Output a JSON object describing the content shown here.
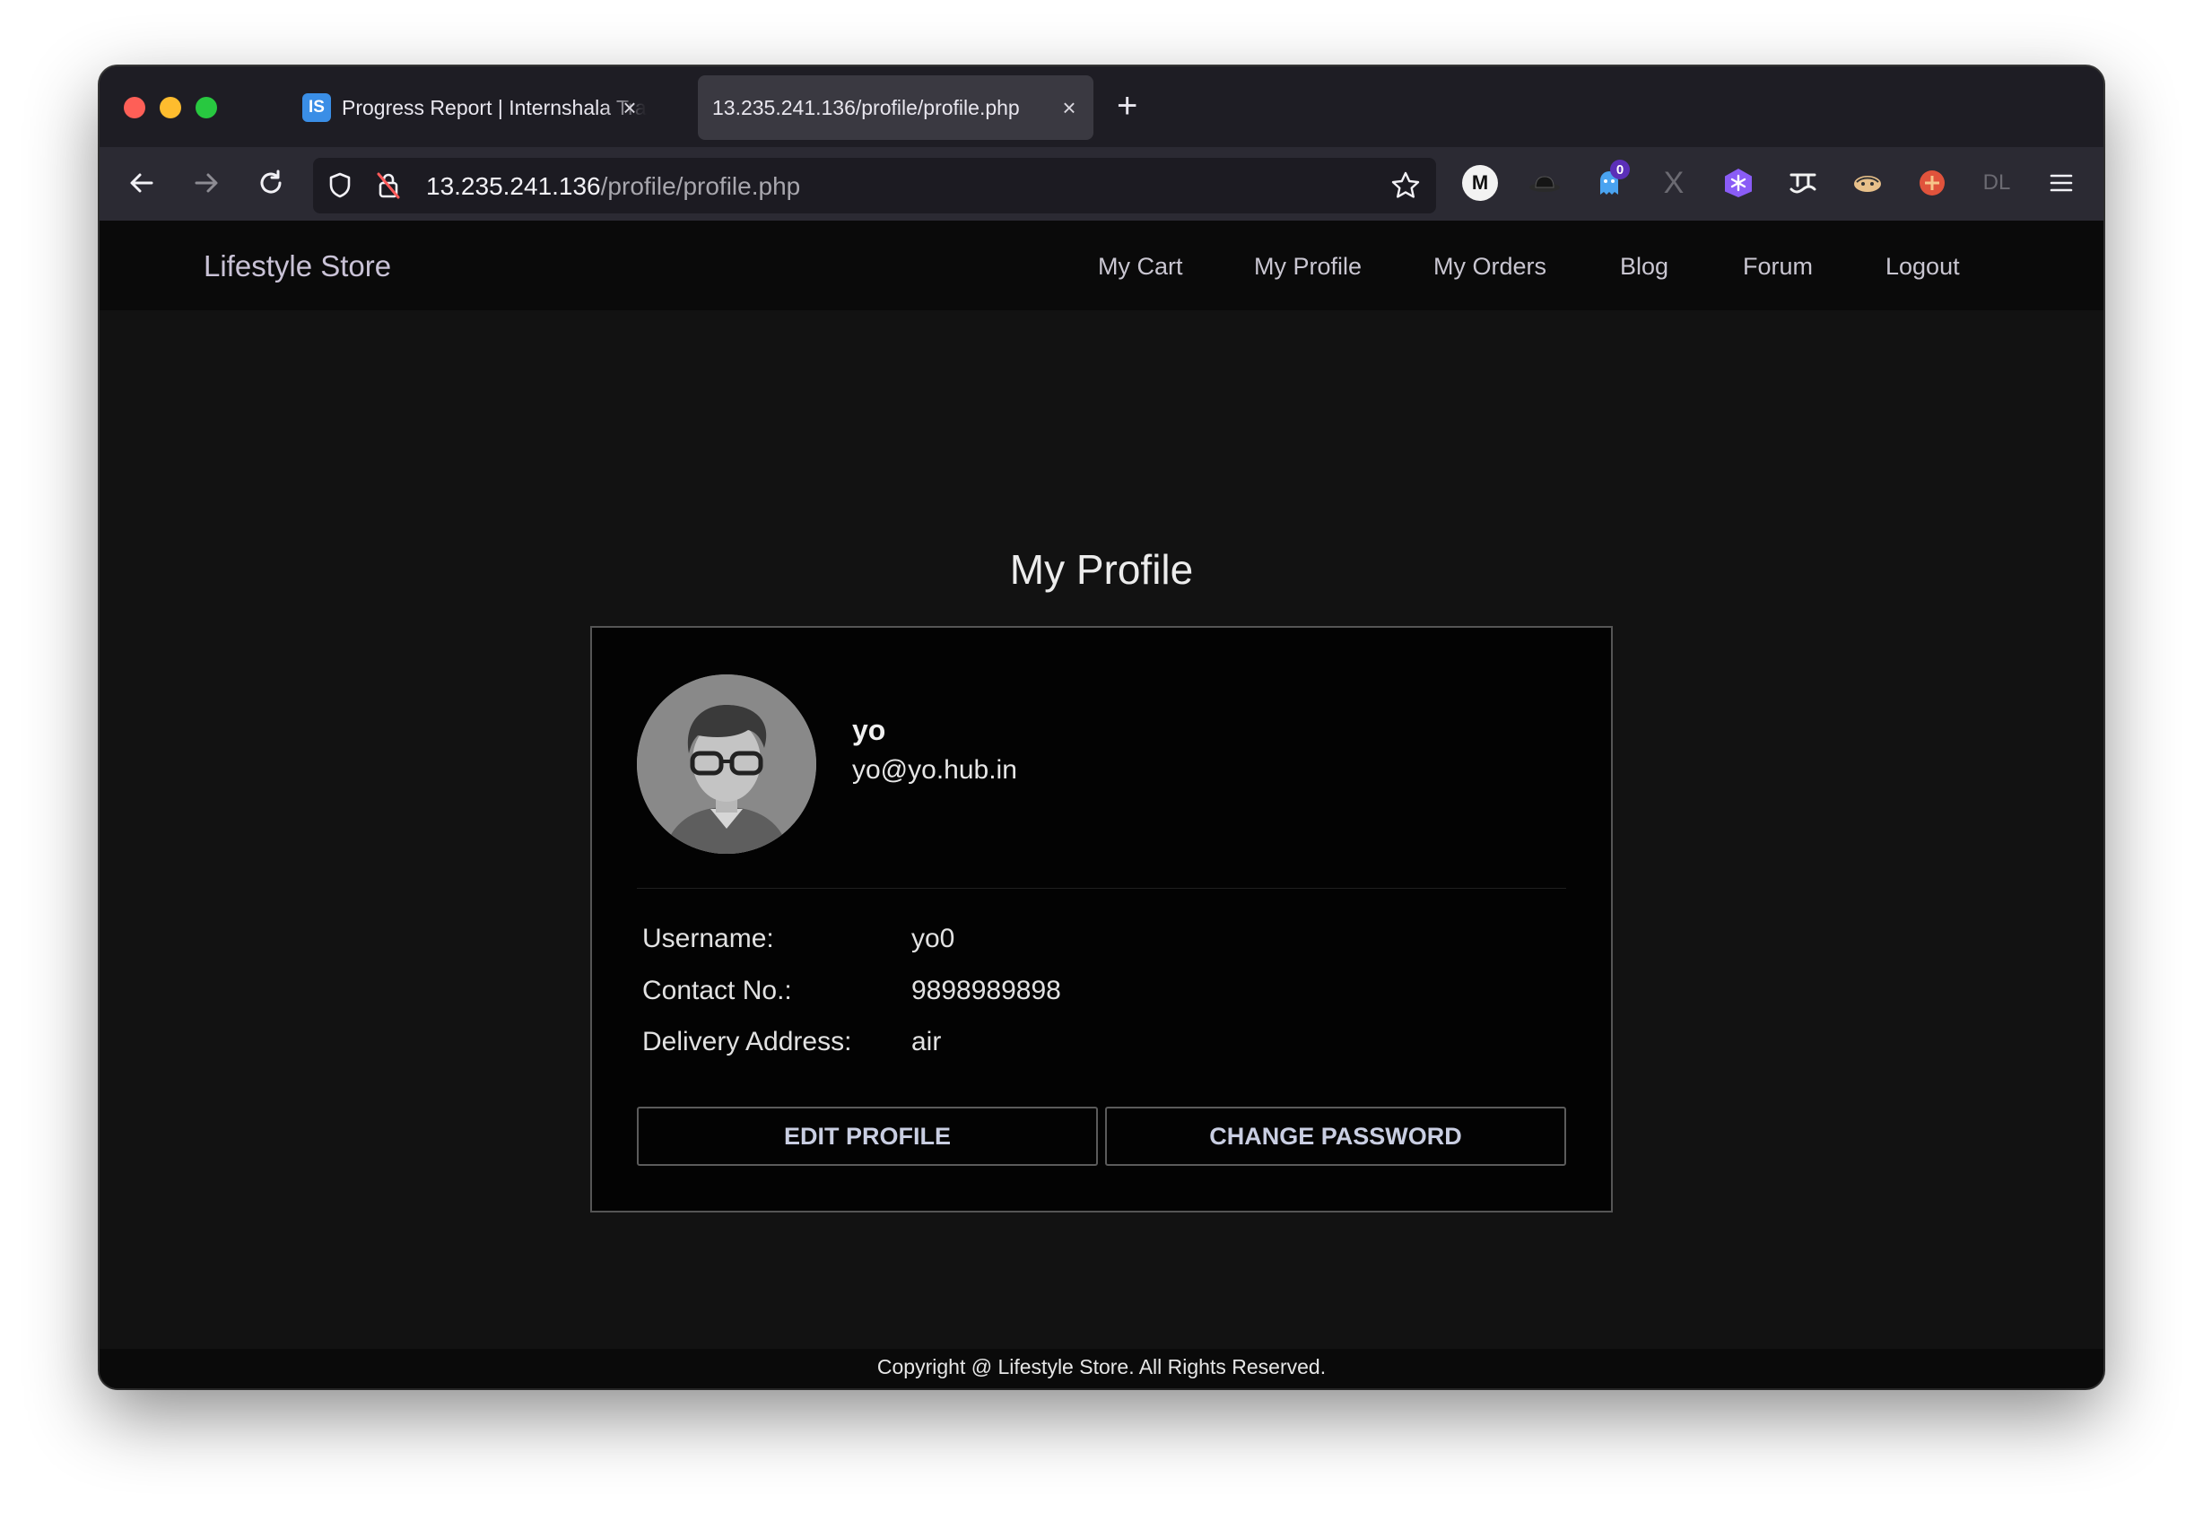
{
  "browser": {
    "tabs": [
      {
        "favicon": "IS",
        "title": "Progress Report | Internshala Trainings",
        "active": false
      },
      {
        "title": "13.235.241.136/profile/profile.php",
        "active": true
      }
    ],
    "url": {
      "host": "13.235.241.136",
      "path": "/profile/profile.php"
    },
    "extension_badge": "0",
    "icons": [
      "back-icon",
      "forward-icon",
      "reload-icon",
      "shield-icon",
      "insecure-lock-icon",
      "bookmark-star-icon",
      "menu-icon"
    ]
  },
  "site": {
    "brand": "Lifestyle Store",
    "nav": [
      "My Cart",
      "My Profile",
      "My Orders",
      "Blog",
      "Forum",
      "Logout"
    ]
  },
  "profile": {
    "heading": "My Profile",
    "name": "yo",
    "email": "yo@yo.hub.in",
    "fields": [
      {
        "label": "Username:",
        "value": "yo0"
      },
      {
        "label": "Contact No.:",
        "value": "9898989898"
      },
      {
        "label": "Delivery Address:",
        "value": "air"
      }
    ],
    "edit_button": "EDIT PROFILE",
    "password_button": "CHANGE PASSWORD"
  },
  "footer": {
    "copyright": "Copyright @ Lifestyle Store. All Rights Reserved."
  }
}
